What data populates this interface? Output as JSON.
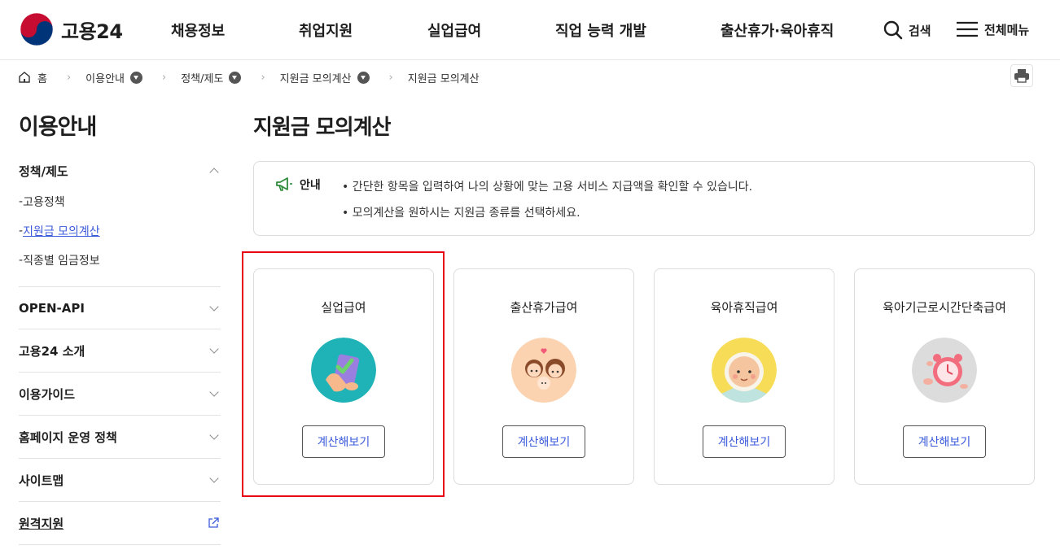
{
  "header": {
    "logo_text": "고용24",
    "nav": [
      "채용정보",
      "취업지원",
      "실업급여",
      "직업 능력 개발",
      "출산휴가·육아휴직"
    ],
    "search_label": "검색",
    "allmenu_label": "전체메뉴"
  },
  "breadcrumb": {
    "home": "홈",
    "items": [
      "이용안내",
      "정책/제도",
      "지원금 모의계산",
      "지원금 모의계산"
    ]
  },
  "sidebar": {
    "title": "이용안내",
    "open_group": {
      "label": "정책/제도",
      "items": [
        "고용정책",
        "지원금 모의계산",
        "직종별 임금정보"
      ],
      "active_index": 1
    },
    "groups": [
      "OPEN-API",
      "고용24 소개",
      "이용가이드",
      "홈페이지 운영 정책",
      "사이트맵",
      "원격지원"
    ]
  },
  "main": {
    "title": "지원금 모의계산",
    "notice": {
      "label": "안내",
      "lines": [
        "간단한 항목을 입력하여 나의 상황에 맞는 고용 서비스 지급액을 확인할 수 있습니다.",
        "모의계산을 원하시는 지원금 종류를 선택하세요."
      ]
    },
    "cards": [
      {
        "title": "실업급여",
        "button": "계산해보기",
        "icon": "phone-check-illustration",
        "color": "#1fb3b8"
      },
      {
        "title": "출산휴가급여",
        "button": "계산해보기",
        "icon": "parents-baby-illustration",
        "color": "#fbd3b0"
      },
      {
        "title": "육아휴직급여",
        "button": "계산해보기",
        "icon": "baby-face-illustration",
        "color": "#f7dc57"
      },
      {
        "title": "육아기근로시간단축급여",
        "button": "계산해보기",
        "icon": "alarm-clock-illustration",
        "color": "#dcdcdc"
      }
    ]
  },
  "colors": {
    "accent": "#3b5bdb",
    "highlight": "#e60012"
  }
}
